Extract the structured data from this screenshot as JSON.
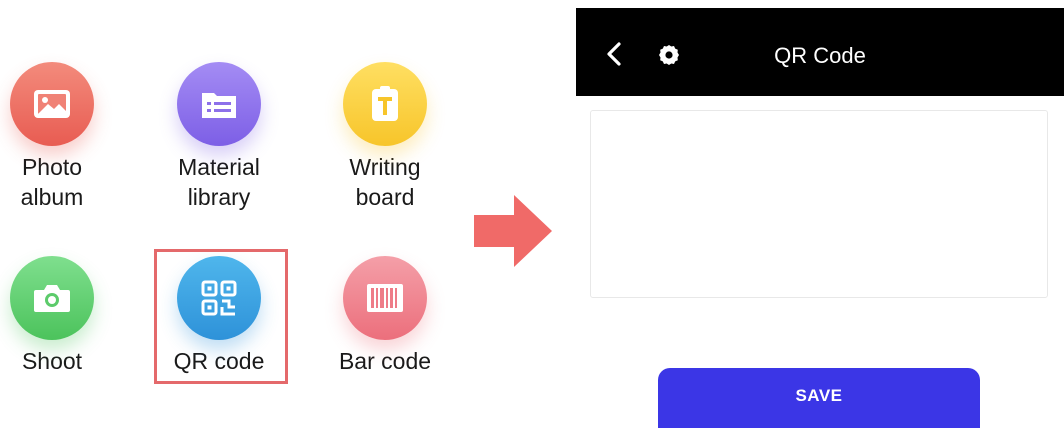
{
  "menu": {
    "items": [
      {
        "label": "Photo\nalbum",
        "icon": "photo-icon",
        "color": "#e85c52"
      },
      {
        "label": "Material\nlibrary",
        "icon": "material-list-icon",
        "color": "#7d5fe6"
      },
      {
        "label": "Writing\nboard",
        "icon": "writing-board-icon",
        "color": "#f7c52a"
      },
      {
        "label": "Shoot",
        "icon": "camera-icon",
        "color": "#4cc35c"
      },
      {
        "label": "QR code",
        "icon": "qr-code-icon",
        "color": "#2e92d9"
      },
      {
        "label": "Bar code",
        "icon": "barcode-icon",
        "color": "#ec6f7c"
      }
    ],
    "highlighted_item": "QR code",
    "highlight_color": "#e4696b"
  },
  "arrow": {
    "icon": "arrow-right-icon",
    "color": "#f06a68"
  },
  "screen": {
    "app_bar": {
      "title": "QR Code",
      "back_icon": "chevron-left-icon",
      "settings_icon": "gear-icon",
      "background": "#000000"
    },
    "save_button": {
      "label": "SAVE",
      "color": "#3b36e6"
    }
  }
}
